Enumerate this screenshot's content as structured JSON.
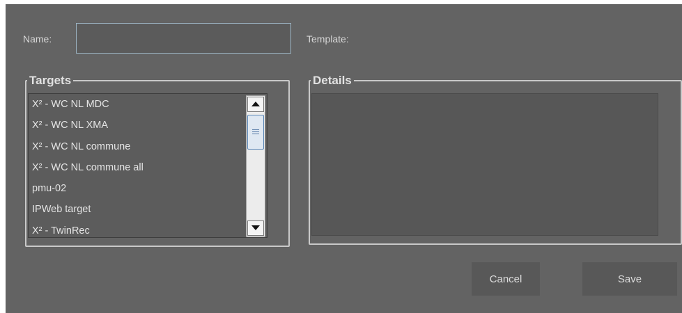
{
  "form": {
    "name_label": "Name:",
    "name_value": "",
    "template_label": "Template:"
  },
  "targets": {
    "legend": "Targets",
    "items": [
      "X² - WC NL MDC",
      "X² - WC NL XMA",
      "X² - WC NL commune",
      "X² - WC NL commune all",
      "pmu-02",
      "IPWeb target",
      "X² - TwinRec"
    ]
  },
  "details": {
    "legend": "Details"
  },
  "buttons": {
    "cancel": "Cancel",
    "save": "Save"
  },
  "icons": {
    "scroll_up": "arrow-up-icon",
    "scroll_down": "arrow-down-icon",
    "scroll_thumb": "grip-icon"
  },
  "colors": {
    "dialog_bg": "#636363",
    "button_bg": "#585858",
    "input_border": "#9eb6c6"
  }
}
